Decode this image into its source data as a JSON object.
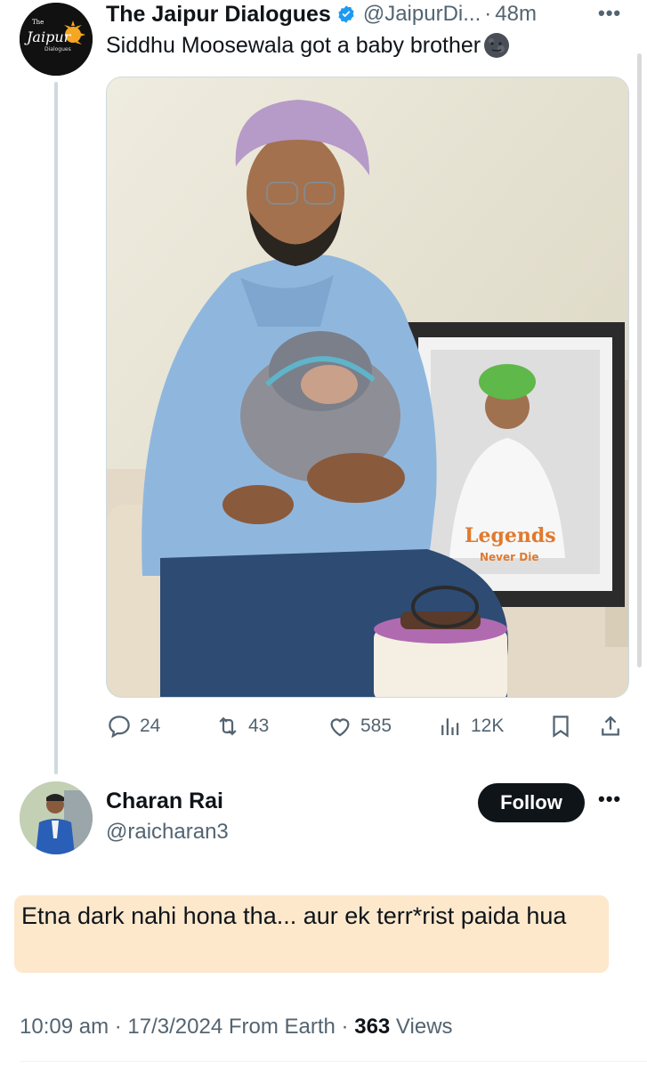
{
  "parent_tweet": {
    "author_name": "The Jaipur Dialogues",
    "handle": "@JaipurDi...",
    "separator": "·",
    "time": "48m",
    "text": "Siddhu Moosewala got a baby brother",
    "avatar_logo_text": "Jaipur",
    "avatar_logo_top": "The",
    "avatar_logo_bottom": "Dialogues",
    "photo": {
      "frame_text_line1": "Legends",
      "frame_text_line2": "Never Die"
    },
    "actions": {
      "replies": "24",
      "retweets": "43",
      "likes": "585",
      "views": "12K"
    }
  },
  "reply": {
    "author_name": "Charan Rai",
    "handle": "@raicharan3",
    "follow_label": "Follow",
    "text": "Etna dark nahi hona tha... aur ek terr*rist paida hua",
    "meta_time": "10:09 am",
    "meta_sep1": " · ",
    "meta_date": "17/3/2024",
    "meta_source": " From Earth",
    "meta_sep2": " · ",
    "meta_views_count": "363",
    "meta_views_label": " Views"
  },
  "colors": {
    "verified": "#1d9bf0",
    "highlight": "#fde8cc",
    "muted_text": "#536471",
    "primary_text": "#0f1419"
  }
}
